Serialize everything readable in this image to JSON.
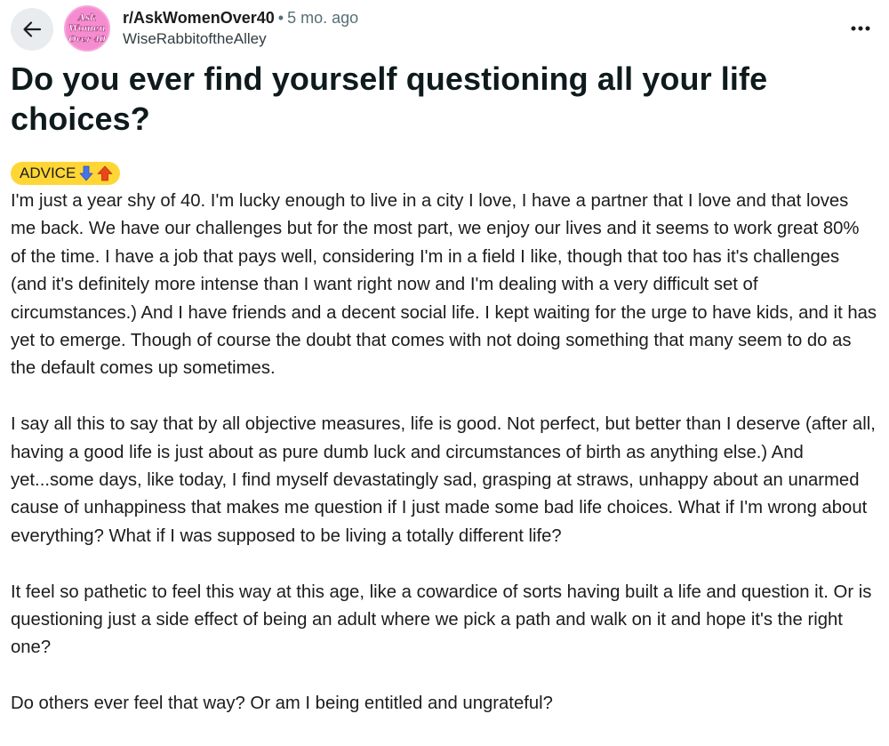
{
  "header": {
    "back_icon": "arrow-left-icon",
    "subreddit": "r/AskWomenOver40",
    "separator": "•",
    "age": "5 mo. ago",
    "author": "WiseRabbitoftheAlley",
    "avatar_lines": [
      "Ask",
      "Women",
      "Over 40"
    ],
    "more_icon": "more-horizontal-icon"
  },
  "post": {
    "title": "Do you ever find yourself questioning all your life choices?",
    "flair": {
      "label": "ADVICE",
      "icons": [
        "arrow-down-icon",
        "arrow-up-icon"
      ],
      "background": "#ffd635"
    },
    "paragraphs": [
      "I'm just a year shy of 40. I'm lucky enough to live in a city I love, I have a partner that I love and that loves me back. We have our challenges but for the most part, we enjoy our lives and it seems to work great 80% of the time. I have a job that pays well, considering I'm in a field I like, though that too has it's challenges (and it's definitely more intense than I want right now and I'm dealing with a very difficult set of circumstances.) And I have friends and a decent social life. I kept waiting for the urge to have kids, and it has yet to emerge. Though of course the doubt that comes with not doing something that many seem to do as the default comes up sometimes.",
      "I say all this to say that by all objective measures, life is good. Not perfect, but better than I deserve (after all, having a good life is just about as pure dumb luck and circumstances of birth as anything else.) And yet...some days, like today, I find myself devastatingly sad, grasping at straws, unhappy about an unarmed cause of unhappiness that makes me question if I just made some bad life choices. What if I'm wrong about everything? What if I was supposed to be living a totally different life?",
      "It feel so pathetic to feel this way at this age, like a cowardice of sorts having built a life and question it. Or is questioning just a side effect of being an adult where we pick a path and walk on it and hope it's the right one?",
      "Do others ever feel that way? Or am I being entitled and ungrateful?"
    ]
  },
  "colors": {
    "text": "#1c1c1c",
    "meta_text": "#576f76",
    "back_button_bg": "#e9ecee",
    "avatar_bg": "#f58ccf",
    "flair_bg": "#ffd635",
    "flair_up_arrow": "#e8471c",
    "flair_down_arrow": "#4a73e8"
  }
}
